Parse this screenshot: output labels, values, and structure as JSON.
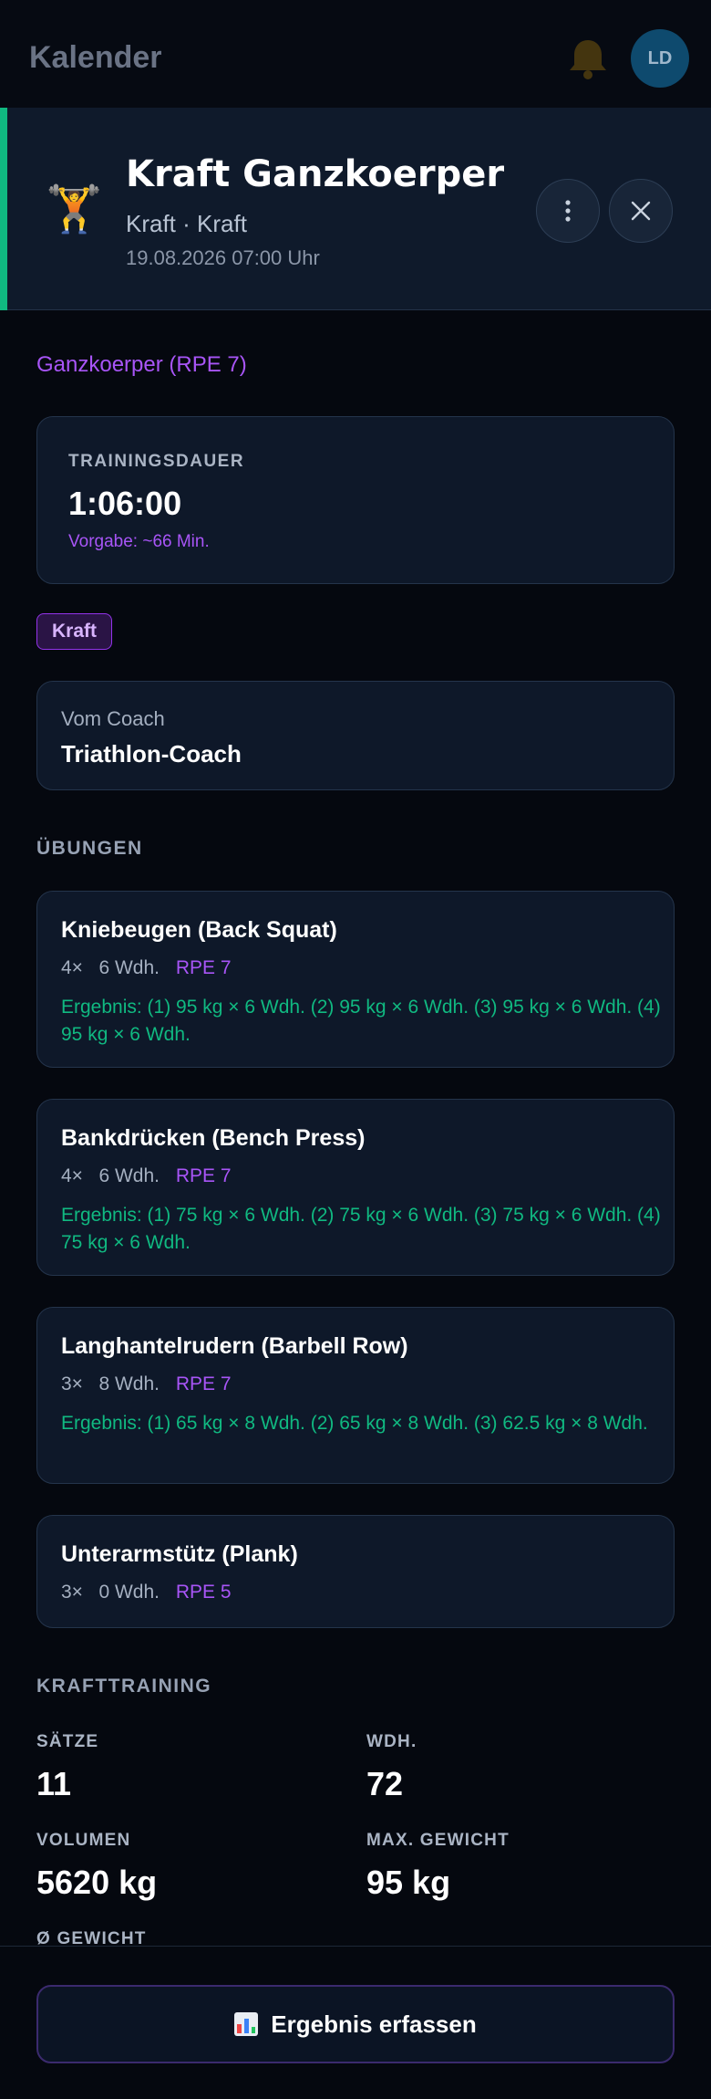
{
  "app": {
    "title": "Kalender",
    "avatar_initials": "LD"
  },
  "workout": {
    "emoji": "🏋️",
    "title": "Kraft Ganzkoerper",
    "subtitle": "Kraft · Kraft",
    "datetime": "19.08.2026 07:00 Uhr",
    "focus": "Ganzkoerper (RPE 7)",
    "accent_color": "#10b981"
  },
  "duration": {
    "label": "TRAININGSDAUER",
    "value": "1:06:00",
    "target": "Vorgabe: ~66 Min."
  },
  "tag": "Kraft",
  "coach": {
    "label": "Vom Coach",
    "name": "Triathlon-Coach"
  },
  "exercises_title": "ÜBUNGEN",
  "exercises": [
    {
      "name": "Kniebeugen (Back Squat)",
      "sets": "4×",
      "reps": "6 Wdh.",
      "rpe": "RPE 7",
      "result": "Ergebnis: (1) 95 kg × 6 Wdh. (2) 95 kg × 6 Wdh. (3) 95 kg × 6 Wdh. (4) 95 kg × 6 Wdh."
    },
    {
      "name": "Bankdrücken (Bench Press)",
      "sets": "4×",
      "reps": "6 Wdh.",
      "rpe": "RPE 7",
      "result": "Ergebnis: (1) 75 kg × 6 Wdh. (2) 75 kg × 6 Wdh. (3) 75 kg × 6 Wdh. (4) 75 kg × 6 Wdh."
    },
    {
      "name": "Langhantelrudern (Barbell Row)",
      "sets": "3×",
      "reps": "8 Wdh.",
      "rpe": "RPE 7",
      "result": "Ergebnis: (1) 65 kg × 8 Wdh. (2) 65 kg × 8 Wdh. (3) 62.5 kg × 8 Wdh."
    },
    {
      "name": "Unterarmstütz (Plank)",
      "sets": "3×",
      "reps": "0 Wdh.",
      "rpe": "RPE 5",
      "result": ""
    }
  ],
  "strength": {
    "title": "KRAFTTRAINING",
    "stats": [
      {
        "label": "SÄTZE",
        "value": "11"
      },
      {
        "label": "WDH.",
        "value": "72"
      },
      {
        "label": "VOLUMEN",
        "value": "5620 kg"
      },
      {
        "label": "MAX. GEWICHT",
        "value": "95 kg"
      },
      {
        "label": "Ø GEWICHT",
        "value": ""
      }
    ]
  },
  "actions": {
    "record_result": "Ergebnis erfassen"
  }
}
